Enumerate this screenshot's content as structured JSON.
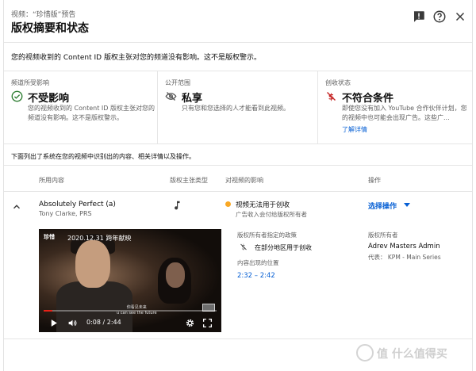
{
  "header": {
    "subtitle": "视频：“珍惜版”预告",
    "title": "版权摘要和状态",
    "icons": [
      "feedback-icon",
      "help-icon",
      "close-icon"
    ]
  },
  "notice": "您的视频收到的 Content ID 版权主张对您的频道没有影响。这不是版权警示。",
  "summary": {
    "channel": {
      "label": "频道所受影响",
      "value": "不受影响",
      "desc": "您的视频收到的 Content ID 版权主张对您的频道没有影响。这不是版权警示。",
      "icon": "check-circle-icon"
    },
    "visibility": {
      "label": "公开范围",
      "value": "私享",
      "desc": "只有您和您选择的人才能看到此视频。",
      "icon": "eye-off-icon"
    },
    "monetization": {
      "label": "创收状态",
      "value": "不符合条件",
      "desc": "即使您没有加入 YouTube 合作伙伴计划，您的视频中也可能会出现广告。这些广...",
      "link": "了解详情",
      "icon": "no-dollar-icon"
    }
  },
  "list_info": "下面列出了系统在您的视频中识别出的内容、相关详情以及操作。",
  "table": {
    "headers": {
      "content": "所用内容",
      "claim_type": "版权主张类型",
      "impact": "对视频的影响",
      "action": "操作"
    },
    "row": {
      "song": "Absolutely Perfect (a)",
      "artist": "Tony Clarke, PRS",
      "claim_icon": "music-note-icon",
      "status": "视频无法用于创收",
      "status_sub": "广告收入会付给版权所有者",
      "status_color": "#f9a825",
      "action": "选择操作"
    }
  },
  "video": {
    "logo": "珍惜",
    "date": "2020.12.31 跨年献映",
    "subtitle_cn": "你看见未来",
    "subtitle_en": "u can see the future",
    "time": "0:08 / 2:44",
    "progress_fraction": 0.049
  },
  "policy": {
    "label": "版权所有者指定的政策",
    "region": "在部分地区用于创收",
    "owner_label": "版权所有者",
    "owner": "Adrev Masters Admin",
    "rep": "代表：  KPM - Main Series",
    "position_label": "内容出现的位置",
    "position": "2:32 – 2:42"
  },
  "watermark": "值 什么值得买"
}
